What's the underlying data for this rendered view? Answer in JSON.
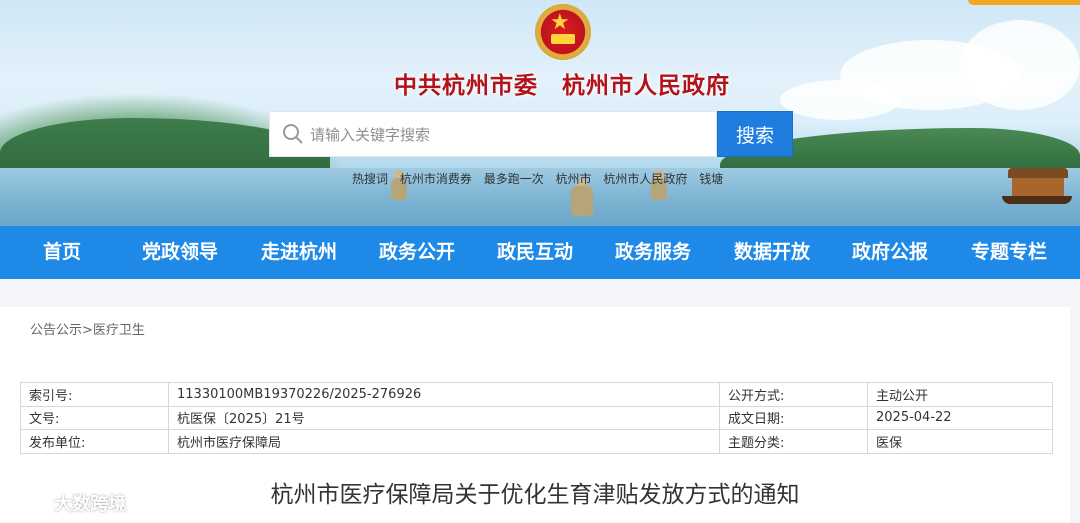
{
  "site": {
    "title": "中共杭州市委　杭州市人民政府"
  },
  "search": {
    "placeholder": "请输入关键字搜索",
    "button_label": "搜索"
  },
  "hot_words": [
    "热搜词",
    "杭州市消费券",
    "最多跑一次",
    "杭州市",
    "杭州市人民政府",
    "钱塘"
  ],
  "nav": {
    "items": [
      "首页",
      "党政领导",
      "走进杭州",
      "政务公开",
      "政民互动",
      "政务服务",
      "数据开放",
      "政府公报",
      "专题专栏"
    ]
  },
  "breadcrumb": {
    "section": "公告公示",
    "separator": ">",
    "category": "医疗卫生"
  },
  "meta": {
    "rows": [
      {
        "k1": "索引号:",
        "v1": "11330100MB19370226/2025-276926",
        "k2": "公开方式:",
        "v2": "主动公开"
      },
      {
        "k1": "文号:",
        "v1": "杭医保〔2025〕21号",
        "k2": "成文日期:",
        "v2": "2025-04-22"
      },
      {
        "k1": "发布单位:",
        "v1": "杭州市医疗保障局",
        "k2": "主题分类:",
        "v2": "医保"
      }
    ]
  },
  "document": {
    "title": "杭州市医疗保障局关于优化生育津贴发放方式的通知"
  },
  "watermark": {
    "text": "大数跨境"
  },
  "colors": {
    "nav_bg": "#1e89e6",
    "search_button": "#1f7de0",
    "title_red": "#b3121b",
    "accent_tab": "#f5a623"
  }
}
